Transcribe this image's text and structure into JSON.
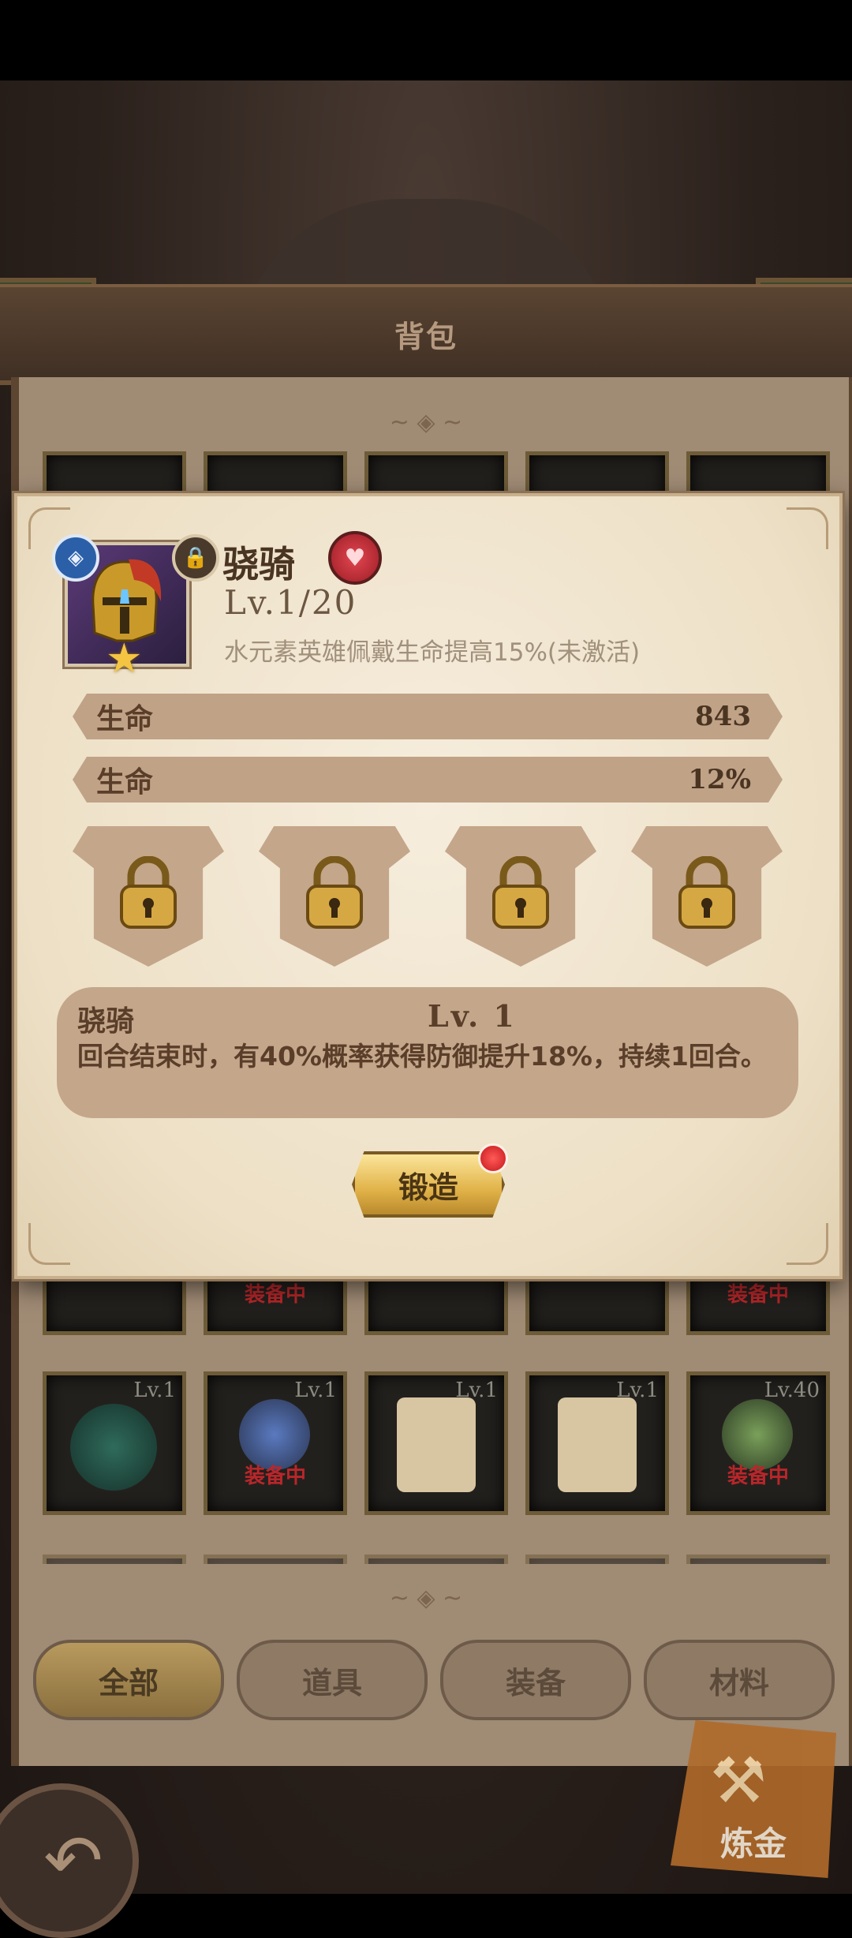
{
  "header": {
    "title": "背包"
  },
  "inventory": {
    "row_top": [
      {
        "lv": "",
        "equipped": ""
      },
      {
        "lv": "",
        "equipped": ""
      },
      {
        "lv": "",
        "equipped": ""
      },
      {
        "lv": "",
        "equipped": ""
      },
      {
        "lv": "",
        "equipped": ""
      }
    ],
    "row_partial": [
      {
        "lv": "",
        "equipped": ""
      },
      {
        "lv": "",
        "equipped": "装备中"
      },
      {
        "lv": "",
        "equipped": ""
      },
      {
        "lv": "",
        "equipped": ""
      },
      {
        "lv": "",
        "equipped": "装备中"
      }
    ],
    "row_main": [
      {
        "lv": "Lv.1",
        "equipped": "",
        "icon": "green-hood-icon"
      },
      {
        "lv": "Lv.1",
        "equipped": "装备中",
        "icon": "dragon-portrait-icon"
      },
      {
        "lv": "Lv.1",
        "equipped": "",
        "icon": "map-scroll-icon"
      },
      {
        "lv": "Lv.1",
        "equipped": "",
        "icon": "map-scroll-icon"
      },
      {
        "lv": "Lv.40",
        "equipped": "装备中",
        "icon": "orc-portrait-icon"
      }
    ]
  },
  "tabs": [
    {
      "label": "全部",
      "active": true
    },
    {
      "label": "道具",
      "active": false
    },
    {
      "label": "装备",
      "active": false
    },
    {
      "label": "材料",
      "active": false
    }
  ],
  "alchemy_label": "炼金",
  "item": {
    "name": "骁骑",
    "level": "Lv.1/20",
    "set_bonus": "水元素英雄佩戴生命提高15%(未激活)",
    "stars": 1,
    "element": "water",
    "locked": true,
    "stats": [
      {
        "label": "生命",
        "value": "843"
      },
      {
        "label": "生命",
        "value": "12%"
      }
    ],
    "gem_slots": [
      "locked",
      "locked",
      "locked",
      "locked"
    ],
    "skill": {
      "name": "骁骑",
      "level": "Lv. 1",
      "description": "回合结束时，有40%概率获得防御提升18%，持续1回合。"
    },
    "forge_label": "锻造",
    "forge_has_notification": true
  },
  "colors": {
    "accent_gold": "#e1b248",
    "panel_bg": "#f6eddd",
    "stat_bar": "#c0a286",
    "equipped_red": "#b9262a",
    "notification_red": "#c4161c"
  }
}
